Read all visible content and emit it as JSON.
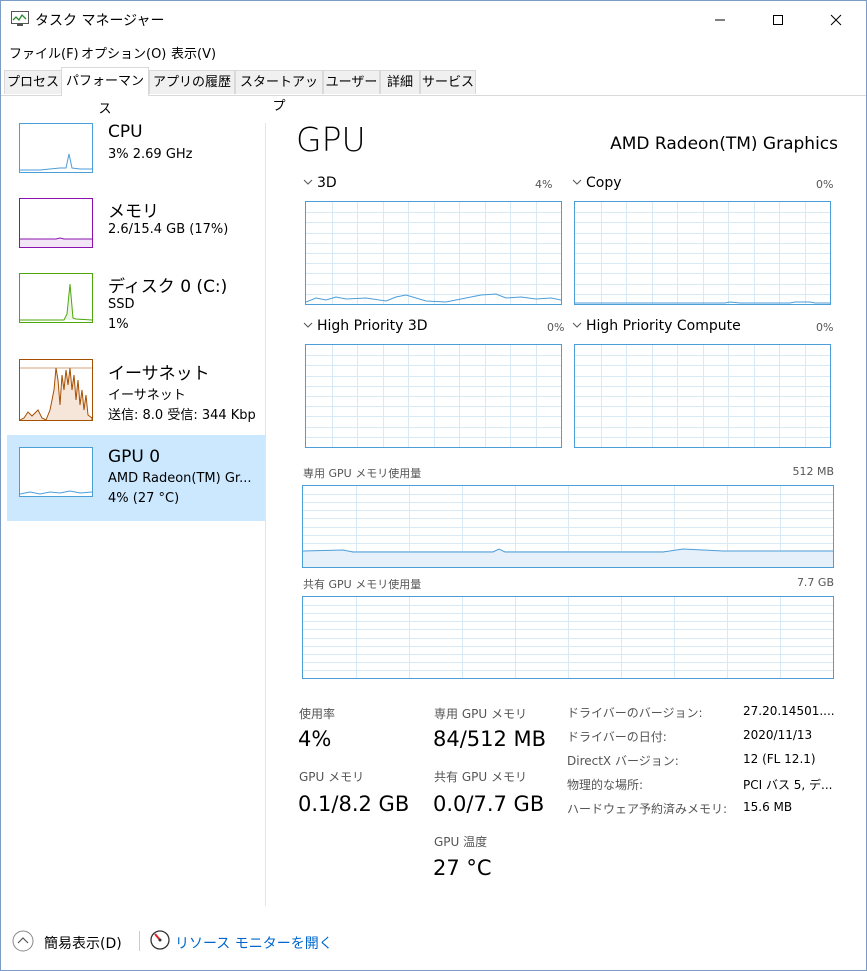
{
  "window": {
    "title": "タスク マネージャー"
  },
  "menu": {
    "file": "ファイル(F)",
    "options": "オプション(O)",
    "view": "表示(V)"
  },
  "tabs": [
    {
      "label": "プロセス"
    },
    {
      "label": "パフォーマンス"
    },
    {
      "label": "アプリの履歴"
    },
    {
      "label": "スタートアップ"
    },
    {
      "label": "ユーザー"
    },
    {
      "label": "詳細"
    },
    {
      "label": "サービス"
    }
  ],
  "sidebar": {
    "cpu": {
      "name": "CPU",
      "sub1": "3% 2.69 GHz"
    },
    "memory": {
      "name": "メモリ",
      "sub1": "2.6/15.4 GB (17%)"
    },
    "disk": {
      "name": "ディスク 0 (C:)",
      "sub1": "SSD",
      "sub2": "1%"
    },
    "ethernet": {
      "name": "イーサネット",
      "sub1": "イーサネット",
      "sub2": "送信: 8.0 受信: 344 Kbp"
    },
    "gpu": {
      "name": "GPU 0",
      "sub1": "AMD Radeon(TM) Gr...",
      "sub2": "4% (27 °C)"
    }
  },
  "main": {
    "title": "GPU",
    "model": "AMD Radeon(TM) Graphics",
    "engines": [
      {
        "label": "3D",
        "pct": "4%"
      },
      {
        "label": "Copy",
        "pct": "0%"
      },
      {
        "label": "High Priority 3D",
        "pct": "0%"
      },
      {
        "label": "High Priority Compute",
        "pct": "0%"
      }
    ],
    "dedicated": {
      "label": "専用 GPU メモリ使用量",
      "max": "512 MB"
    },
    "shared": {
      "label": "共有 GPU メモリ使用量",
      "max": "7.7 GB"
    },
    "stats": {
      "usage_label": "使用率",
      "usage": "4%",
      "gpu_mem_label": "GPU メモリ",
      "gpu_mem": "0.1/8.2 GB",
      "ded_label": "専用 GPU メモリ",
      "ded": "84/512 MB",
      "shared_label": "共有 GPU メモリ",
      "shared": "0.0/7.7 GB",
      "temp_label": "GPU 温度",
      "temp": "27 °C"
    },
    "info": [
      {
        "key": "ドライバーのバージョン:",
        "val": "27.20.14501...."
      },
      {
        "key": "ドライバーの日付:",
        "val": "2020/11/13"
      },
      {
        "key": "DirectX バージョン:",
        "val": "12 (FL 12.1)"
      },
      {
        "key": "物理的な場所:",
        "val": "PCI バス 5, デ..."
      },
      {
        "key": "ハードウェア予約済みメモリ:",
        "val": "15.6 MB"
      }
    ]
  },
  "footer": {
    "fewer": "簡易表示(D)",
    "resmon": "リソース モニターを開く"
  },
  "colors": {
    "gpu": "#4c9ed9",
    "memory": "#8b12ae",
    "disk": "#4da60c",
    "ethernet": "#a74f01",
    "selected": "#cce8ff"
  }
}
